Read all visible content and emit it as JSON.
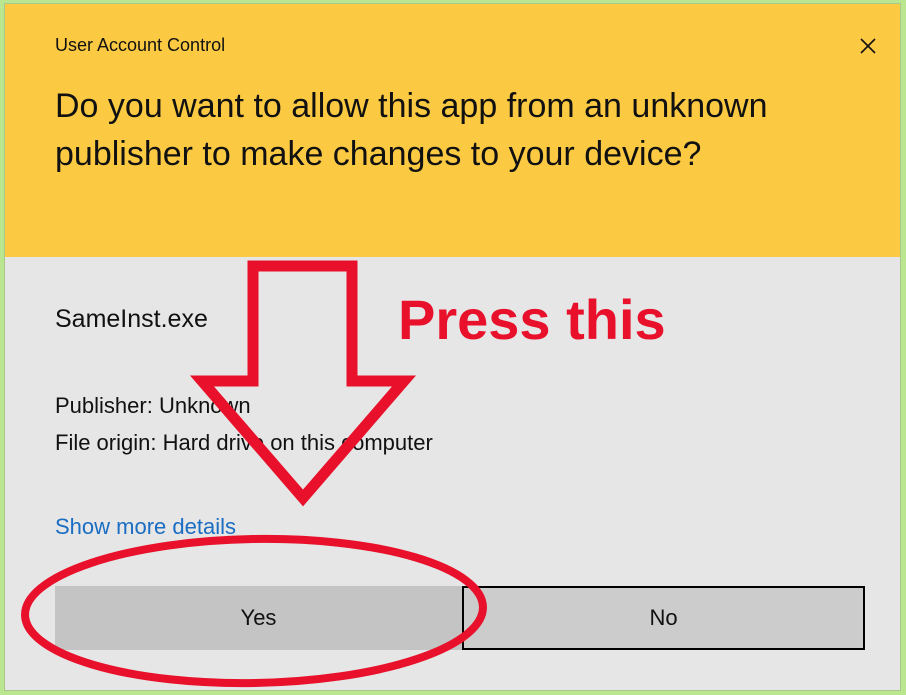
{
  "dialog": {
    "title": "User Account Control",
    "close_icon": "close-icon",
    "question": "Do you want to allow this app from an unknown publisher to make changes to your device?",
    "app_name": "SameInst.exe",
    "publisher": "Publisher: Unknown",
    "file_origin": "File origin: Hard drive on this computer",
    "details_link": "Show more details",
    "yes_label": "Yes",
    "no_label": "No"
  },
  "annotation": {
    "text": "Press this",
    "color": "#e8102a",
    "arrow_icon": "down-arrow-icon",
    "circle_icon": "highlight-ellipse-icon"
  },
  "colors": {
    "header": "#fbca42",
    "body": "#e6e6e6",
    "page": "#b9e68f",
    "link": "#1a6dc2",
    "button": "#cccccc"
  }
}
